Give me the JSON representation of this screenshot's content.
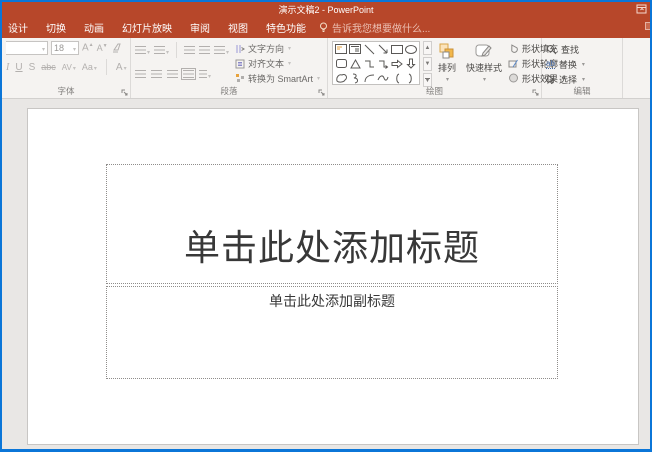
{
  "titlebar": {
    "title": "演示文稿2 - PowerPoint"
  },
  "tabs": {
    "items": [
      "设计",
      "切换",
      "动画",
      "幻灯片放映",
      "审阅",
      "视图",
      "特色功能"
    ],
    "tell_me": "告诉我您想要做什么..."
  },
  "font_group": {
    "label": "字体",
    "font_size": "18",
    "grow_font": "A",
    "shrink_font": "A",
    "italic": "I",
    "underline": "U",
    "shadow": "S",
    "strikethrough": "abc",
    "spacing": "AV",
    "case": "Aa",
    "font_color": "A"
  },
  "paragraph_group": {
    "label": "段落",
    "text_direction": "文字方向",
    "align_text": "对齐文本",
    "smartart": "转换为 SmartArt"
  },
  "drawing_group": {
    "label": "绘图",
    "arrange": "排列",
    "quick_styles": "快速样式",
    "shape_fill": "形状填充",
    "shape_outline": "形状轮廓",
    "shape_effects": "形状效果"
  },
  "editing_group": {
    "label": "编辑",
    "find": "查找",
    "replace": "替换",
    "replace_icon": "ab",
    "select": "选择"
  },
  "slide": {
    "title_placeholder": "单击此处添加标题",
    "subtitle_placeholder": "单击此处添加副标题"
  },
  "colors": {
    "titlebar": "#b7472a",
    "window_border": "#0b76d8",
    "accent": "#f2b74a"
  }
}
